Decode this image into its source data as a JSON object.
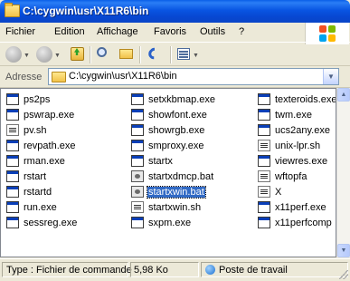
{
  "window": {
    "title": "C:\\cygwin\\usr\\X11R6\\bin"
  },
  "menu": {
    "items": [
      "Fichier",
      "Edition",
      "Affichage",
      "Favoris",
      "Outils",
      "?"
    ]
  },
  "toolbar": {
    "folder_icon": "folder-icon",
    "views_icon": "views-icon"
  },
  "address": {
    "label": "Adresse",
    "value": "C:\\cygwin\\usr\\X11R6\\bin"
  },
  "files": {
    "col1": [
      {
        "name": "ps2ps",
        "icon": "exe"
      },
      {
        "name": "pswrap.exe",
        "icon": "exe"
      },
      {
        "name": "pv.sh",
        "icon": "sh"
      },
      {
        "name": "revpath.exe",
        "icon": "exe"
      },
      {
        "name": "rman.exe",
        "icon": "exe"
      },
      {
        "name": "rstart",
        "icon": "exe"
      },
      {
        "name": "rstartd",
        "icon": "exe"
      },
      {
        "name": "run.exe",
        "icon": "exe"
      },
      {
        "name": "sessreg.exe",
        "icon": "exe"
      }
    ],
    "col2": [
      {
        "name": "setxkbmap.exe",
        "icon": "exe"
      },
      {
        "name": "showfont.exe",
        "icon": "exe"
      },
      {
        "name": "showrgb.exe",
        "icon": "exe"
      },
      {
        "name": "smproxy.exe",
        "icon": "exe"
      },
      {
        "name": "startx",
        "icon": "exe"
      },
      {
        "name": "startxdmcp.bat",
        "icon": "bat"
      },
      {
        "name": "startxwin.bat",
        "icon": "bat",
        "selected": true
      },
      {
        "name": "startxwin.sh",
        "icon": "sh"
      },
      {
        "name": "sxpm.exe",
        "icon": "exe"
      }
    ],
    "col3": [
      {
        "name": "texteroids.exe",
        "icon": "exe"
      },
      {
        "name": "twm.exe",
        "icon": "exe"
      },
      {
        "name": "ucs2any.exe",
        "icon": "exe"
      },
      {
        "name": "unix-lpr.sh",
        "icon": "sh"
      },
      {
        "name": "viewres.exe",
        "icon": "exe"
      },
      {
        "name": "wftopfa",
        "icon": "sh"
      },
      {
        "name": "X",
        "icon": "sh"
      },
      {
        "name": "x11perf.exe",
        "icon": "exe"
      },
      {
        "name": "x11perfcomp",
        "icon": "exe"
      }
    ]
  },
  "status": {
    "type": "Type : Fichier de commande",
    "size": "5,98 Ko",
    "zone": "Poste de travail"
  },
  "colors": {
    "titlebar": "#0a5fe8",
    "selection": "#316ac5",
    "chrome": "#ece9d8"
  }
}
